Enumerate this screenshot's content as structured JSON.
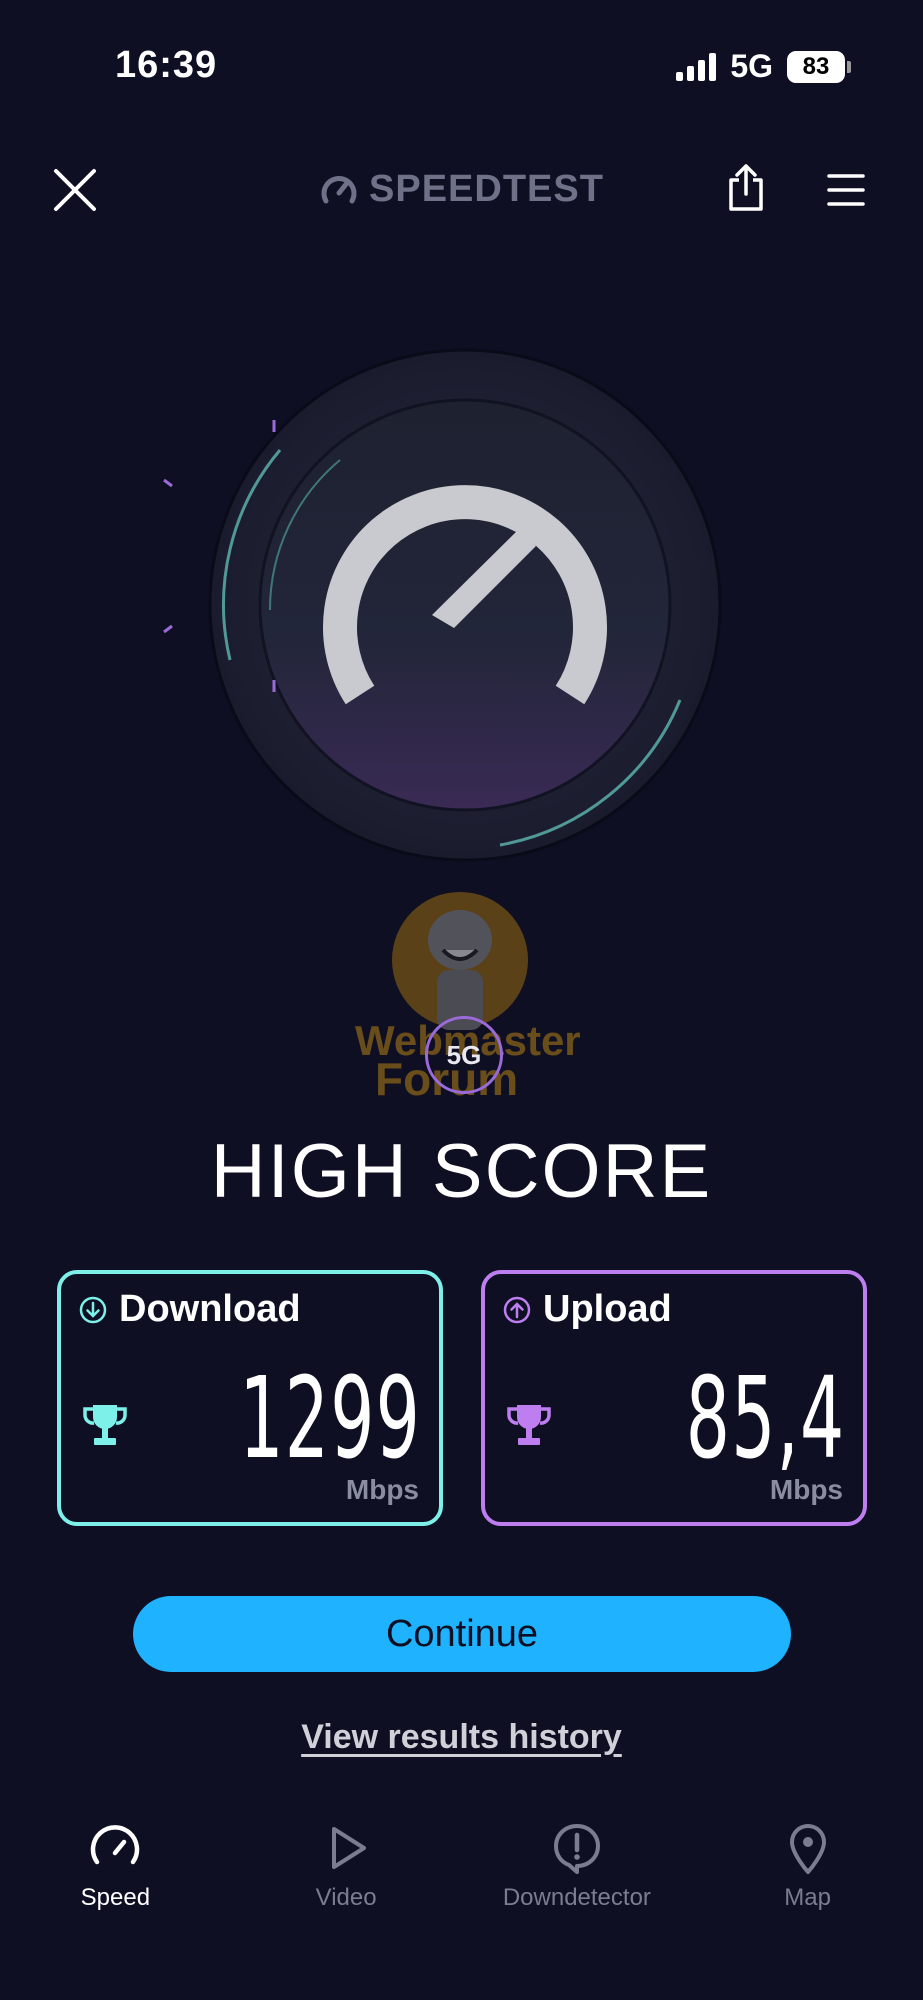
{
  "status_bar": {
    "time": "16:39",
    "network": "5G",
    "battery": "83"
  },
  "header": {
    "brand": "SPEEDTEST"
  },
  "gauge": {
    "badge": "5G"
  },
  "result": {
    "headline": "HIGH SCORE",
    "download": {
      "label": "Download",
      "value": "1299",
      "unit": "Mbps",
      "color": "#7df0ea"
    },
    "upload": {
      "label": "Upload",
      "value": "85,4",
      "unit": "Mbps",
      "color": "#bf7ef0"
    }
  },
  "actions": {
    "continue": "Continue",
    "history": "View results history"
  },
  "watermark": {
    "text": "Webmaster Forum"
  },
  "nav": {
    "items": [
      {
        "label": "Speed",
        "icon": "speedometer-icon",
        "active": true
      },
      {
        "label": "Video",
        "icon": "play-icon",
        "active": false
      },
      {
        "label": "Downdetector",
        "icon": "alert-icon",
        "active": false
      },
      {
        "label": "Map",
        "icon": "map-pin-icon",
        "active": false
      }
    ]
  },
  "colors": {
    "background": "#0e0f22",
    "accent": "#1eb2ff"
  }
}
